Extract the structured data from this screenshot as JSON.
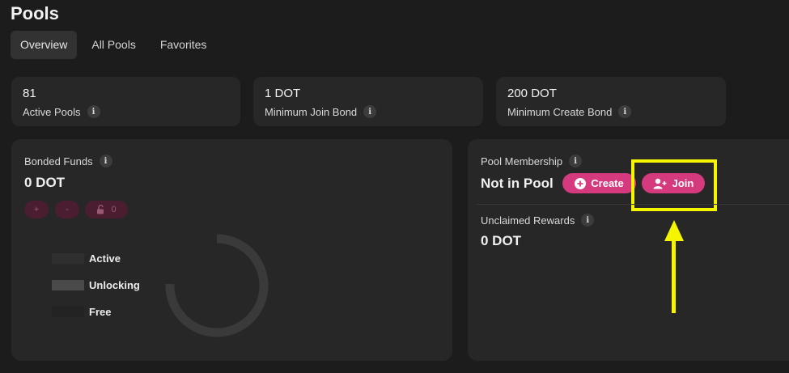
{
  "page": {
    "title": "Pools"
  },
  "tabs": [
    {
      "label": "Overview",
      "active": true
    },
    {
      "label": "All Pools",
      "active": false
    },
    {
      "label": "Favorites",
      "active": false
    }
  ],
  "stats": [
    {
      "value": "81",
      "label": "Active Pools",
      "info_icon": "i"
    },
    {
      "value": "1 DOT",
      "label": "Minimum Join Bond",
      "info_icon": "i"
    },
    {
      "value": "200 DOT",
      "label": "Minimum Create Bond",
      "info_icon": "i"
    }
  ],
  "bonded": {
    "label": "Bonded Funds",
    "info_icon": "i",
    "value": "0 DOT",
    "buttons": {
      "plus": "+",
      "minus": "-",
      "unlock_count": "0"
    },
    "legend": [
      {
        "label": "Active",
        "color": "#2f2f2f"
      },
      {
        "label": "Unlocking",
        "color": "#4a4a4a"
      },
      {
        "label": "Free",
        "color": "#232323"
      }
    ],
    "donut_color": "#3a3a3a"
  },
  "membership": {
    "label": "Pool Membership",
    "info_icon": "i",
    "status": "Not in Pool",
    "create_label": "Create",
    "join_label": "Join",
    "accent_color": "#d63a7e"
  },
  "rewards": {
    "label": "Unclaimed Rewards",
    "info_icon": "i",
    "value": "0 DOT"
  },
  "annotation": {
    "color": "#f5f500"
  }
}
